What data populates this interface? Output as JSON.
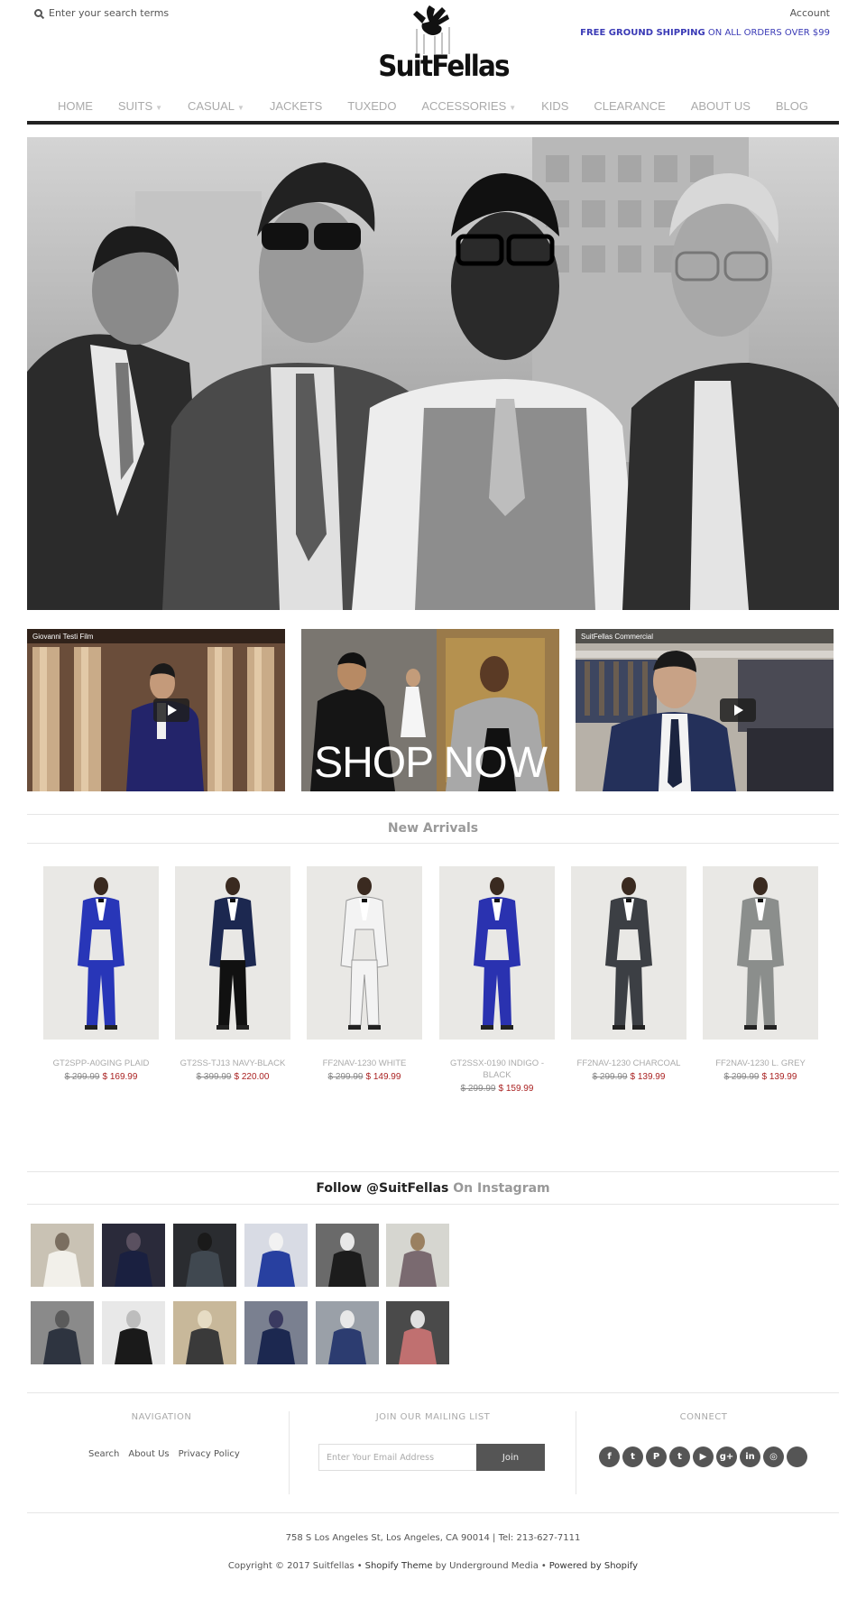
{
  "header": {
    "search_placeholder": "Enter your search terms",
    "account_label": "Account",
    "shipping_bold": "FREE GROUND SHIPPING",
    "shipping_rest": "ON ALL ORDERS OVER $99",
    "logo_text": "SuitFellas"
  },
  "nav": {
    "items": [
      {
        "label": "HOME"
      },
      {
        "label": "SUITS",
        "dropdown": true
      },
      {
        "label": "CASUAL",
        "dropdown": true
      },
      {
        "label": "JACKETS"
      },
      {
        "label": "TUXEDO"
      },
      {
        "label": "ACCESSORIES",
        "dropdown": true
      },
      {
        "label": "KIDS"
      },
      {
        "label": "CLEARANCE"
      },
      {
        "label": "ABOUT US"
      },
      {
        "label": "BLOG"
      }
    ]
  },
  "promos": {
    "video1_title": "Giovanni Testi Film",
    "shop_now": "SHOP NOW",
    "video2_title": "SuitFellas Commercial"
  },
  "new_arrivals": {
    "title": "New Arrivals",
    "products": [
      {
        "name": "GT2SPP-A0GING PLAID",
        "old_price": "$ 299.99",
        "new_price": "$ 169.99",
        "suit_color": "#2836b8",
        "shirt": "#ffffff",
        "pants": "#2836b8"
      },
      {
        "name": "GT2SS-TJ13 NAVY-BLACK",
        "old_price": "$ 399.99",
        "new_price": "$ 220.00",
        "suit_color": "#1c2850",
        "shirt": "#ffffff",
        "pants": "#111111"
      },
      {
        "name": "FF2NAV-1230 WHITE",
        "old_price": "$ 299.99",
        "new_price": "$ 149.99",
        "suit_color": "#f3f3f3",
        "shirt": "#ffffff",
        "pants": "#f3f3f3"
      },
      {
        "name": "GT2SSX-0190 INDIGO - BLACK",
        "old_price": "$ 299.99",
        "new_price": "$ 159.99",
        "suit_color": "#2a32b0",
        "shirt": "#ffffff",
        "pants": "#2a32b0"
      },
      {
        "name": "FF2NAV-1230 CHARCOAL",
        "old_price": "$ 299.99",
        "new_price": "$ 139.99",
        "suit_color": "#3c3f44",
        "shirt": "#ffffff",
        "pants": "#3c3f44"
      },
      {
        "name": "FF2NAV-1230 L. GREY",
        "old_price": "$ 299.99",
        "new_price": "$ 139.99",
        "suit_color": "#8b8e8c",
        "shirt": "#ffffff",
        "pants": "#8b8e8c"
      }
    ]
  },
  "instagram": {
    "title_dark": "Follow @SuitFellas",
    "title_light": "On Instagram"
  },
  "footer": {
    "navigation_heading": "NAVIGATION",
    "nav_links": [
      "Search",
      "About Us",
      "Privacy Policy"
    ],
    "mailing_heading": "JOIN OUR MAILING LIST",
    "email_placeholder": "Enter Your Email Address",
    "join_label": "Join",
    "connect_heading": "CONNECT",
    "address": "758 S Los Angeles St, Los Angeles, CA 90014 | Tel: 213-627-7111",
    "copyright": "Copyright © 2017 Suitfellas",
    "theme_link": "Shopify Theme",
    "by_text": "by Underground Media",
    "powered": "Powered by Shopify"
  }
}
